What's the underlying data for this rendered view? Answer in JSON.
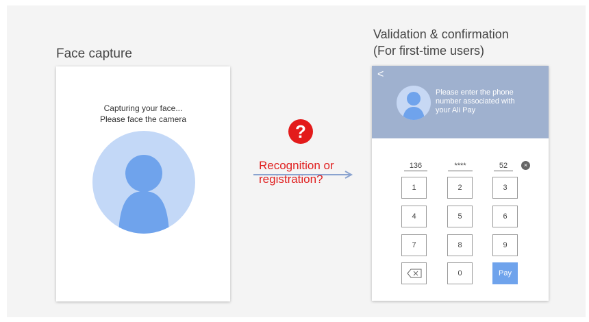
{
  "left": {
    "title": "Face capture",
    "line1": "Capturing your face...",
    "line2": "Please face the camera"
  },
  "middle": {
    "icon": "question-icon",
    "qmark": "?",
    "label_line1": "Recognition or",
    "label_line2": "registration?"
  },
  "right": {
    "title_line1": "Validation & confirmation",
    "title_line2": "(For first-time users)",
    "back_glyph": "<",
    "prompt_line1": "Please enter the phone",
    "prompt_line2": "number associated with",
    "prompt_line3": "your Ali Pay",
    "phone": [
      "136",
      "****",
      "52"
    ],
    "clear_glyph": "×",
    "keys": [
      "1",
      "2",
      "3",
      "4",
      "5",
      "6",
      "7",
      "8",
      "9",
      "0"
    ],
    "pay_label": "Pay"
  },
  "colors": {
    "header": "#9fb1cf",
    "avatar": "#6fa3ec",
    "accent_red": "#e31b1b",
    "pay_button": "#6fa3ec"
  }
}
